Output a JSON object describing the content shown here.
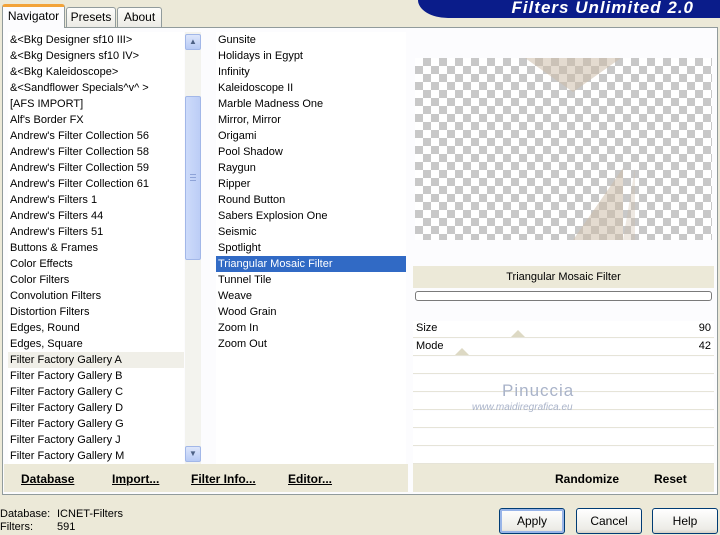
{
  "window": {
    "title": "Filters Unlimited 2.0"
  },
  "tabs": [
    {
      "label": "Navigator"
    },
    {
      "label": "Presets"
    },
    {
      "label": "About"
    }
  ],
  "categories": [
    "&<Bkg Designer sf10 III>",
    "&<Bkg Designers sf10 IV>",
    "&<Bkg Kaleidoscope>",
    "&<Sandflower Specials^v^ >",
    "[AFS IMPORT]",
    "Alf's Border FX",
    "Andrew's Filter Collection 56",
    "Andrew's Filter Collection 58",
    "Andrew's Filter Collection 59",
    "Andrew's Filter Collection 61",
    "Andrew's Filters 1",
    "Andrew's Filters 44",
    "Andrew's Filters 51",
    "Buttons & Frames",
    "Color Effects",
    "Color Filters",
    "Convolution Filters",
    "Distortion Filters",
    "Edges, Round",
    "Edges, Square",
    "Filter Factory Gallery A",
    "Filter Factory Gallery B",
    "Filter Factory Gallery C",
    "Filter Factory Gallery D",
    "Filter Factory Gallery G",
    "Filter Factory Gallery J",
    "Filter Factory Gallery M"
  ],
  "categories_highlighted_index": 20,
  "filters": [
    "Gunsite",
    "Holidays in Egypt",
    "Infinity",
    "Kaleidoscope II",
    "Marble Madness One",
    "Mirror, Mirror",
    "Origami",
    "Pool Shadow",
    "Raygun",
    "Ripper",
    "Round Button",
    "Sabers Explosion One",
    "Seismic",
    "Spotlight",
    "Triangular Mosaic Filter",
    "Tunnel Tile",
    "Weave",
    "Wood Grain",
    "Zoom In",
    "Zoom Out"
  ],
  "filters_selected_index": 14,
  "preview": {
    "filter_name": "Triangular Mosaic Filter"
  },
  "params": [
    {
      "label": "Size",
      "value": "90"
    },
    {
      "label": "Mode",
      "value": "42"
    }
  ],
  "watermark": {
    "name": "Pinuccia",
    "url": "www.maidiregrafica.eu"
  },
  "toolbar": {
    "database": "Database",
    "import": "Import...",
    "filter_info": "Filter Info...",
    "editor": "Editor...",
    "randomize": "Randomize",
    "reset": "Reset"
  },
  "status": {
    "database_label": "Database:",
    "database_value": "ICNET-Filters",
    "filters_label": "Filters:",
    "filters_value": "591"
  },
  "buttons": {
    "apply": "Apply",
    "cancel": "Cancel",
    "help": "Help"
  },
  "colors": {
    "accent": "#316ac5",
    "banner": "#0a1c8a",
    "tab_active": "#f2a339"
  }
}
